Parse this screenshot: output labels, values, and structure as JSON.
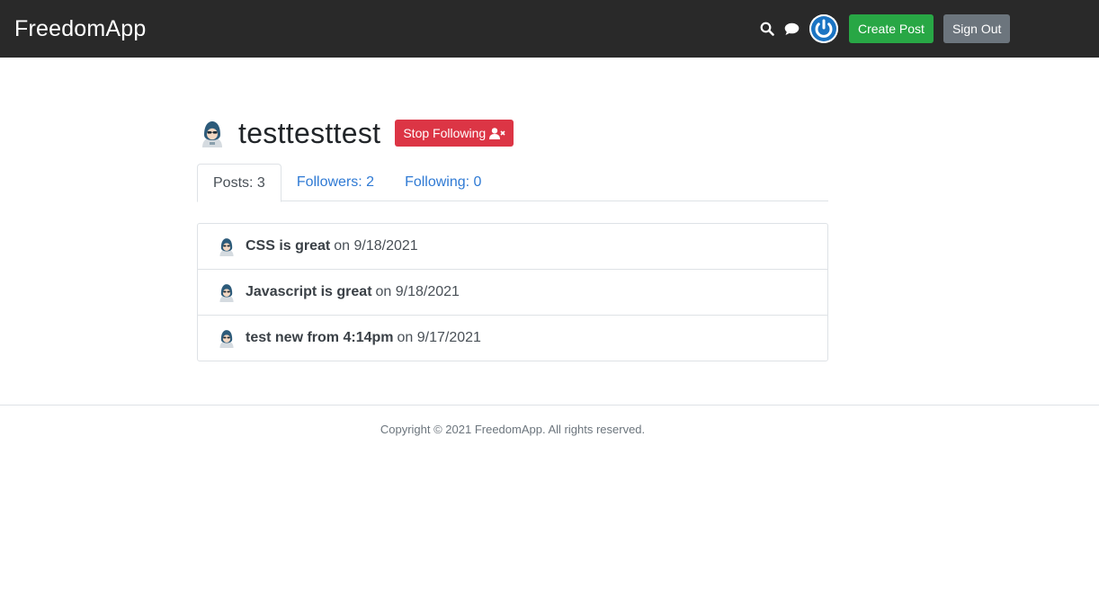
{
  "header": {
    "brand": "FreedomApp",
    "create_post_label": "Create Post",
    "sign_out_label": "Sign Out",
    "icons": [
      "search-icon",
      "chat-icon",
      "avatar-icon"
    ]
  },
  "profile": {
    "username": "testtesttest",
    "stop_following_label": "Stop Following"
  },
  "tabs": [
    {
      "label": "Posts: 3",
      "active": true
    },
    {
      "label": "Followers: 2",
      "active": false
    },
    {
      "label": "Following: 0",
      "active": false
    }
  ],
  "posts": [
    {
      "title": "CSS is great",
      "date": "on 9/18/2021"
    },
    {
      "title": "Javascript is great",
      "date": "on 9/18/2021"
    },
    {
      "title": "test new from 4:14pm",
      "date": "on 9/17/2021"
    }
  ],
  "footer": {
    "copyright": "Copyright © 2021 FreedomApp. All rights reserved."
  },
  "colors": {
    "header_bg": "#292929",
    "create_post": "#28a745",
    "sign_out": "#6c757d",
    "stop_following": "#dc3545",
    "link": "#2f7ad4"
  }
}
